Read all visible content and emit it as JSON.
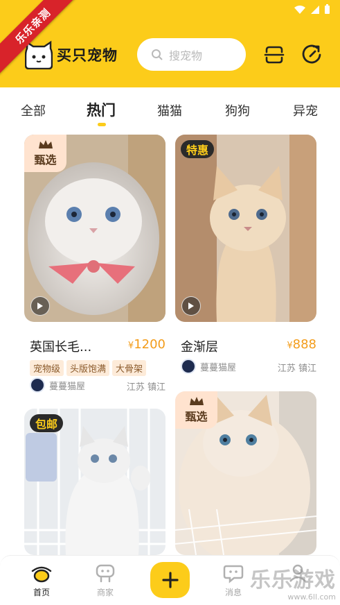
{
  "colors": {
    "brand_yellow": "#fccc1a",
    "price_orange": "#f39c1a",
    "ribbon_red": "#d8232a"
  },
  "ribbon": {
    "text": "乐乐亲测"
  },
  "header": {
    "brand": "买只宠物",
    "search_placeholder": "搜宠物",
    "icons": [
      "search-icon",
      "scan-icon",
      "refresh-icon"
    ]
  },
  "tabs": [
    {
      "label": "全部"
    },
    {
      "label": "热门",
      "active": true
    },
    {
      "label": "猫猫"
    },
    {
      "label": "狗狗"
    },
    {
      "label": "异宠"
    }
  ],
  "listings": [
    {
      "badge": "甄选",
      "title": "英国长毛...",
      "price_symbol": "¥",
      "price": "1200",
      "tags": [
        "宠物级",
        "头版饱满",
        "大骨架"
      ],
      "seller": "蔓蔓猫屋",
      "location": "江苏 镇江"
    },
    {
      "badge": "特惠",
      "title": "金渐层",
      "price_symbol": "¥",
      "price": "888",
      "tags": [],
      "seller": "蔓蔓猫屋",
      "location": "江苏 镇江"
    },
    {
      "badge": "包邮"
    },
    {
      "badge": "甄选"
    }
  ],
  "bottom_nav": {
    "home": "首页",
    "shops": "商家",
    "messages": "消息"
  },
  "watermark": {
    "big": "乐乐游戏",
    "small": "www.6ll.com"
  }
}
